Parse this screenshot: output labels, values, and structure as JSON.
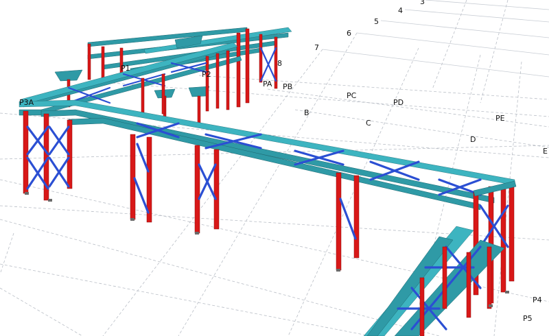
{
  "grid_labels": {
    "numbers": [
      "3",
      "4",
      "5",
      "6",
      "7",
      "8"
    ],
    "letters": [
      "B",
      "C",
      "D",
      "E"
    ],
    "pipe_racks": [
      "P3A",
      "P1",
      "P2",
      "PA",
      "PB",
      "PC",
      "PD",
      "PE",
      "P4",
      "P5"
    ]
  },
  "colors": {
    "column": "#d81818",
    "beam": "#2f9aa6",
    "brace": "#2b4fd3",
    "grid": "#b9bec6"
  }
}
